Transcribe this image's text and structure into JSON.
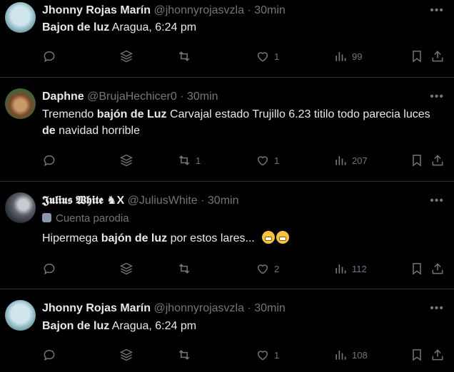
{
  "tweets": [
    {
      "name": "Jhonny Rojas Marín",
      "handle": "@jhonnyrojasvzla",
      "sep": "·",
      "time": "30min",
      "parody": "",
      "text_parts": [
        {
          "t": "Bajon de luz",
          "b": true
        },
        {
          "t": " Aragua, 6:24 pm",
          "b": false
        }
      ],
      "counts": {
        "reply": "",
        "retweet": "",
        "like": "1",
        "views": "99"
      }
    },
    {
      "name": "Daphne",
      "handle": "@BrujaHechicer0",
      "sep": "·",
      "time": "30min",
      "parody": "",
      "text_parts": [
        {
          "t": "Tremendo ",
          "b": false
        },
        {
          "t": "bajón de Luz",
          "b": true
        },
        {
          "t": " Carvajal estado Trujillo 6.23 titilo todo parecia luces ",
          "b": false
        },
        {
          "t": "de",
          "b": true
        },
        {
          "t": "  navidad horrible",
          "b": false
        }
      ],
      "counts": {
        "reply": "",
        "retweet": "1",
        "like": "1",
        "views": "207"
      }
    },
    {
      "name": "𝕵𝖚𝖑𝖎𝖚𝖘 𝖂𝖍𝖎𝖙𝖊 ♞X",
      "handle": "@JuliusWhite",
      "sep": "·",
      "time": "30min",
      "parody": "Cuenta parodia",
      "text_parts": [
        {
          "t": "Hipermega ",
          "b": false
        },
        {
          "t": "bajón de luz",
          "b": true
        },
        {
          "t": " por estos lares...",
          "b": false
        }
      ],
      "counts": {
        "reply": "",
        "retweet": "",
        "like": "2",
        "views": "112"
      }
    },
    {
      "name": "Jhonny Rojas Marín",
      "handle": "@jhonnyrojasvzla",
      "sep": "·",
      "time": "30min",
      "parody": "",
      "text_parts": [
        {
          "t": "Bajon de luz",
          "b": true
        },
        {
          "t": " Aragua, 6:24 pm",
          "b": false
        }
      ],
      "counts": {
        "reply": "",
        "retweet": "",
        "like": "1",
        "views": "108"
      }
    }
  ],
  "icons": {
    "reply": "reply-icon",
    "grok": "grok-icon",
    "retweet": "retweet-icon",
    "like": "heart-icon",
    "views": "views-icon",
    "bookmark": "bookmark-icon",
    "share": "share-icon",
    "more": "more-icon",
    "parody": "theater-mask-icon"
  },
  "colors": {
    "background": "#000000",
    "text": "#e7e9ea",
    "muted": "#71767b",
    "divider": "#2f3336"
  }
}
